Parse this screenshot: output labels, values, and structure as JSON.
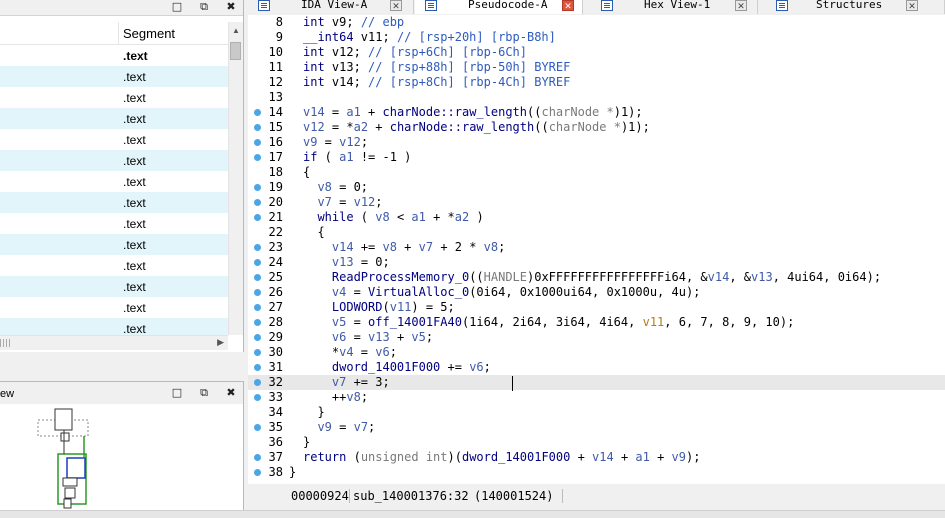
{
  "segments_pane": {
    "column_header": "Segment",
    "rows": [
      ".text",
      ".text",
      ".text",
      ".text",
      ".text",
      ".text",
      ".text",
      ".text",
      ".text",
      ".text",
      ".text",
      ".text",
      ".text",
      ".text"
    ],
    "title_buttons": [
      "□",
      "⧉",
      "✖"
    ]
  },
  "overview_pane": {
    "title": "ew",
    "title_buttons": [
      "□",
      "⧉",
      "✖"
    ]
  },
  "tabs": [
    {
      "label": "IDA View-A",
      "icon": "document-icon"
    },
    {
      "label": "Pseudocode-A",
      "icon": "document-icon"
    },
    {
      "label": "Hex View-1",
      "icon": "hex-icon"
    },
    {
      "label": "Structures",
      "icon": "struct-icon"
    }
  ],
  "code": {
    "lines": [
      {
        "n": "8",
        "bp": false,
        "html": "<span class='kw'>int</span> v9; <span class='cm'>// ebp</span>"
      },
      {
        "n": "9",
        "bp": false,
        "html": "<span class='kw'>__int64</span> v11; <span class='cm'>// [rsp+20h] [rbp-B8h]</span>"
      },
      {
        "n": "10",
        "bp": false,
        "html": "<span class='kw'>int</span> v12; <span class='cm'>// [rsp+6Ch] [rbp-6Ch]</span>"
      },
      {
        "n": "11",
        "bp": false,
        "html": "<span class='kw'>int</span> v13; <span class='cm'>// [rsp+88h] [rbp-50h] BYREF</span>"
      },
      {
        "n": "12",
        "bp": false,
        "html": "<span class='kw'>int</span> v14; <span class='cm'>// [rsp+8Ch] [rbp-4Ch] BYREF</span>"
      },
      {
        "n": "13",
        "bp": false,
        "html": ""
      },
      {
        "n": "14",
        "bp": true,
        "html": "<span class='vr'>v14</span> = <span class='vr'>a1</span> + <span class='fn'>charNode::raw_length</span>((<span class='ty'>charNode *</span>)1);"
      },
      {
        "n": "15",
        "bp": true,
        "html": "<span class='vr'>v12</span> = *<span class='vr'>a2</span> + <span class='fn'>charNode::raw_length</span>((<span class='ty'>charNode *</span>)1);"
      },
      {
        "n": "16",
        "bp": true,
        "html": "<span class='vr'>v9</span> = <span class='vr'>v12</span>;"
      },
      {
        "n": "17",
        "bp": true,
        "html": "<span class='kw'>if</span> ( <span class='vr'>a1</span> != -1 )"
      },
      {
        "n": "18",
        "bp": false,
        "html": "{"
      },
      {
        "n": "19",
        "bp": true,
        "html": "  <span class='vr'>v8</span> = 0;"
      },
      {
        "n": "20",
        "bp": true,
        "html": "  <span class='vr'>v7</span> = <span class='vr'>v12</span>;"
      },
      {
        "n": "21",
        "bp": true,
        "html": "  <span class='kw'>while</span> ( <span class='vr'>v8</span> &lt; <span class='vr'>a1</span> + *<span class='vr'>a2</span> )"
      },
      {
        "n": "22",
        "bp": false,
        "html": "  {"
      },
      {
        "n": "23",
        "bp": true,
        "html": "    <span class='vr'>v14</span> += <span class='vr'>v8</span> + <span class='vr'>v7</span> + 2 * <span class='vr'>v8</span>;"
      },
      {
        "n": "24",
        "bp": true,
        "html": "    <span class='vr'>v13</span> = 0;"
      },
      {
        "n": "25",
        "bp": true,
        "html": "    <span class='fn'>ReadProcessMemory_0</span>((<span class='ty'>HANDLE</span>)0xFFFFFFFFFFFFFFFFi64, &amp;<span class='vr'>v14</span>, &amp;<span class='vr'>v13</span>, 4ui64, 0i64);"
      },
      {
        "n": "26",
        "bp": true,
        "html": "    <span class='vr'>v4</span> = <span class='fn'>VirtualAlloc_0</span>(0i64, 0x1000ui64, 0x1000u, 4u);"
      },
      {
        "n": "27",
        "bp": true,
        "html": "    <span class='fn'>LODWORD</span>(<span class='vr'>v11</span>) = 5;"
      },
      {
        "n": "28",
        "bp": true,
        "html": "    <span class='vr'>v5</span> = <span class='gl'>off_14001FA40</span>(1i64, 2i64, 3i64, 4i64, <span class='hl'>v11</span>, 6, 7, 8, 9, 10);"
      },
      {
        "n": "29",
        "bp": true,
        "html": "    <span class='vr'>v6</span> = <span class='vr'>v13</span> + <span class='vr'>v5</span>;"
      },
      {
        "n": "30",
        "bp": true,
        "html": "    *<span class='vr'>v4</span> = <span class='vr'>v6</span>;"
      },
      {
        "n": "31",
        "bp": true,
        "html": "    <span class='gl'>dword_14001F000</span> += <span class='vr'>v6</span>;"
      },
      {
        "n": "32",
        "bp": true,
        "html": "    <span class='vr'>v7</span> += 3;",
        "current": true
      },
      {
        "n": "33",
        "bp": true,
        "html": "    ++<span class='vr'>v8</span>;"
      },
      {
        "n": "34",
        "bp": false,
        "html": "  }"
      },
      {
        "n": "35",
        "bp": true,
        "html": "  <span class='vr'>v9</span> = <span class='vr'>v7</span>;"
      },
      {
        "n": "36",
        "bp": false,
        "html": "}"
      },
      {
        "n": "37",
        "bp": true,
        "html": "<span class='kw'>return</span> (<span class='ty'>unsigned int</span>)(<span class='gl'>dword_14001F000</span> + <span class='vr'>v14</span> + <span class='vr'>a1</span> + <span class='vr'>v9</span>);"
      },
      {
        "n": "38",
        "bp": true,
        "html": "}",
        "outdent": true
      }
    ]
  },
  "status_bar": {
    "offset": "00000924",
    "location": "sub_140001376:32",
    "address": "(140001524)"
  }
}
